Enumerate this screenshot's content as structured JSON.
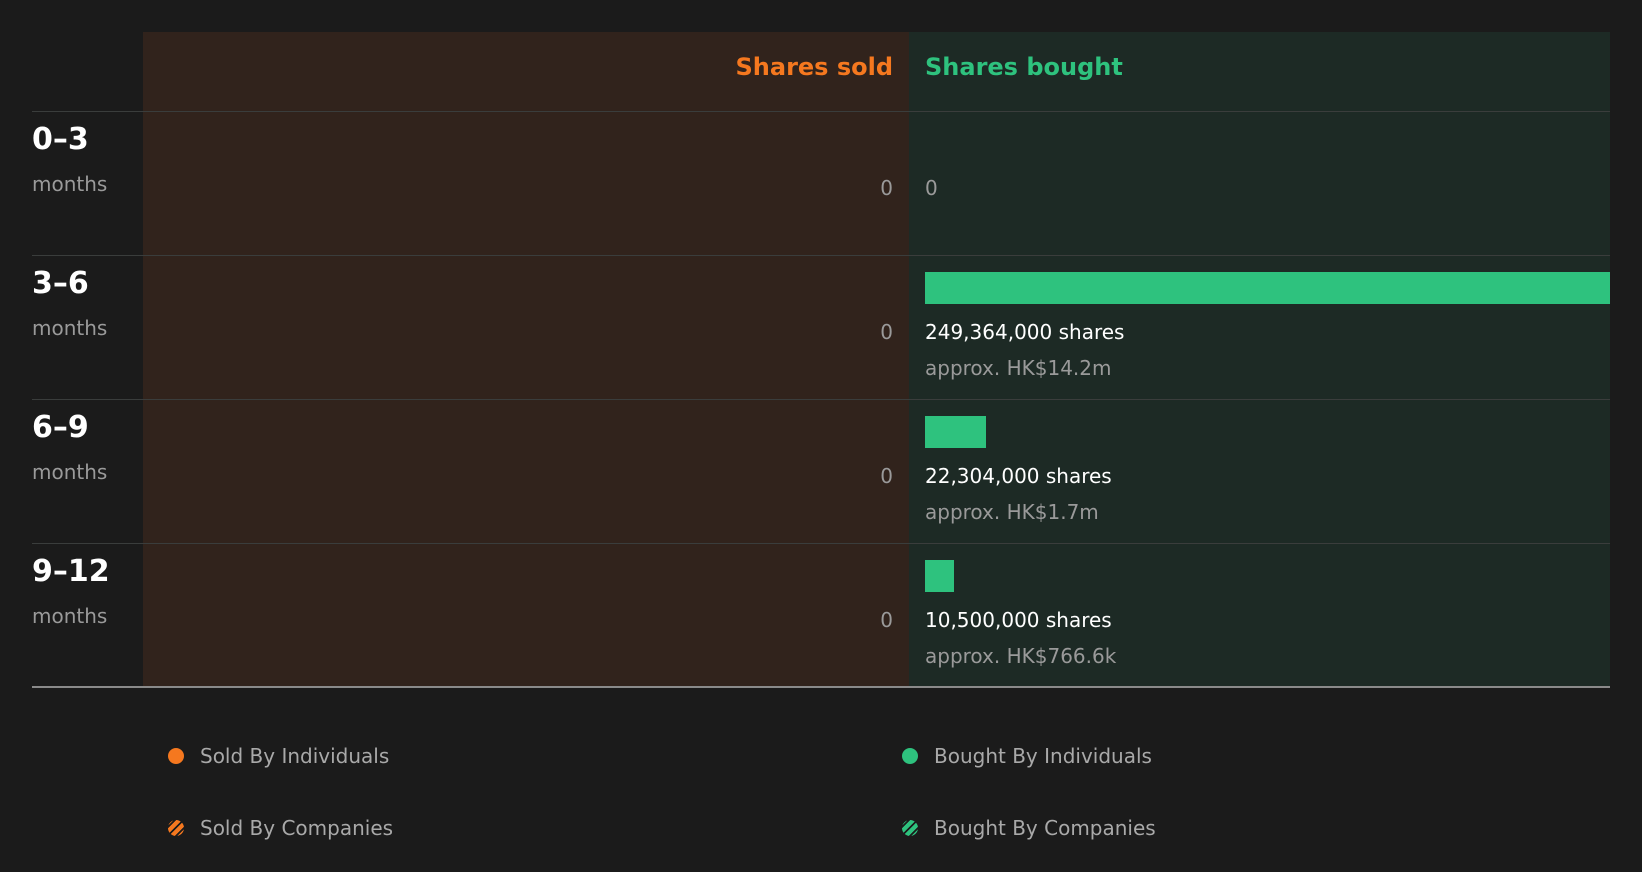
{
  "chart_data": {
    "type": "bar",
    "headers": {
      "sold": "Shares sold",
      "bought": "Shares bought"
    },
    "unit": "months",
    "categories": [
      "0–3",
      "3–6",
      "6–9",
      "9–12"
    ],
    "series": [
      {
        "name": "Shares sold",
        "values": [
          0,
          0,
          0,
          0
        ]
      },
      {
        "name": "Shares bought",
        "values": [
          0,
          249364000,
          22304000,
          10500000
        ]
      }
    ],
    "sold_labels": [
      "0",
      "0",
      "0",
      "0"
    ],
    "bought_labels": [
      "0",
      "249,364,000 shares",
      "22,304,000 shares",
      "10,500,000 shares"
    ],
    "bought_approx": [
      "",
      "approx. HK$14.2m",
      "approx. HK$1.7m",
      "approx. HK$766.6k"
    ],
    "legend": [
      "Sold By Individuals",
      "Bought By Individuals",
      "Sold By Companies",
      "Bought By Companies"
    ],
    "colors": {
      "sold": "#f5781f",
      "bought": "#2ec27e"
    }
  }
}
